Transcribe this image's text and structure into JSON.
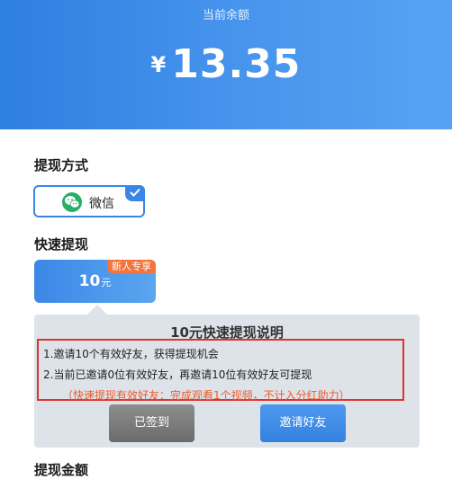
{
  "header": {
    "label": "当前余额",
    "currency_symbol": "¥",
    "balance": "13.35"
  },
  "withdraw_method": {
    "title": "提现方式",
    "options": [
      {
        "label": "微信",
        "icon": "wechat-icon",
        "selected": true
      }
    ]
  },
  "fast_withdraw": {
    "title": "快速提现",
    "option": {
      "amount": "10",
      "unit": "元",
      "badge": "新人专享"
    },
    "info": {
      "title": "10元快速提现说明",
      "rules": [
        "1.邀请10个有效好友，获得提现机会",
        "2.当前已邀请0位有效好友，再邀请10位有效好友可提现"
      ],
      "note": "（快速提现有效好友：完成观看1个视频，不计入分红助力）",
      "note_color": "#ef5a2a",
      "signed_button": "已签到",
      "invite_button": "邀请好友"
    }
  },
  "withdraw_amount": {
    "title": "提现金额"
  },
  "colors": {
    "accent": "#3a86e6",
    "badge": "#f5743c",
    "highlight_border": "#e0312d",
    "wechat": "#2aae67"
  }
}
